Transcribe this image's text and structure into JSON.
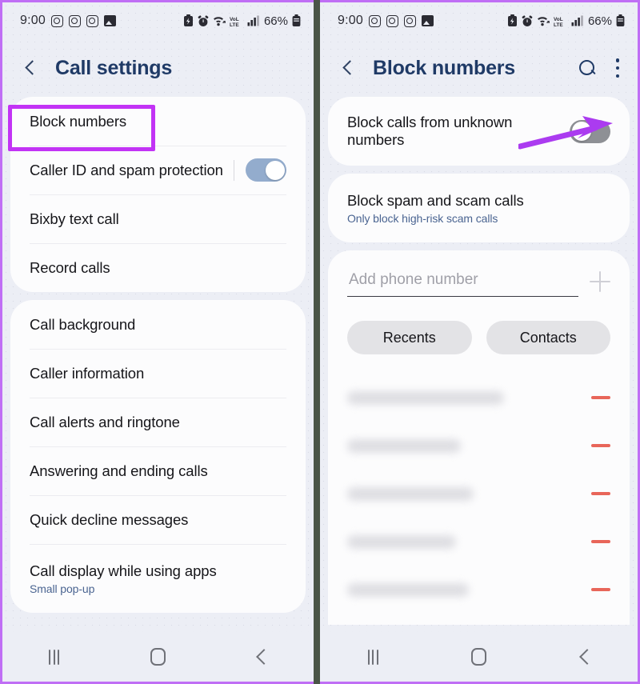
{
  "status_bar": {
    "time": "9:00",
    "left_icons": [
      "instagram-icon",
      "instagram-icon",
      "instagram-icon",
      "gallery-icon"
    ],
    "right_icons": [
      "battery-saver-icon",
      "alarm-icon",
      "wifi-calling-icon",
      "volte-icon",
      "signal-icon"
    ],
    "battery_percent": "66%"
  },
  "left_screen": {
    "header": {
      "back_icon": "back-chevron-icon",
      "title": "Call settings"
    },
    "group_1": [
      {
        "label": "Block numbers",
        "highlighted": true
      },
      {
        "label": "Caller ID and spam protection",
        "toggle": "on"
      },
      {
        "label": "Bixby text call"
      },
      {
        "label": "Record calls"
      }
    ],
    "group_2": [
      {
        "label": "Call background"
      },
      {
        "label": "Caller information"
      },
      {
        "label": "Call alerts and ringtone"
      },
      {
        "label": "Answering and ending calls"
      },
      {
        "label": "Quick decline messages"
      },
      {
        "label": "Call display while using apps",
        "sub": "Small pop-up"
      }
    ]
  },
  "right_screen": {
    "header": {
      "back_icon": "back-chevron-icon",
      "title": "Block numbers",
      "search_icon": "search-icon",
      "menu_icon": "kebab-menu-icon"
    },
    "unknown_numbers": {
      "label": "Block calls from unknown numbers",
      "toggle": "off"
    },
    "spam_calls": {
      "label": "Block spam and scam calls",
      "sub": "Only block high-risk scam calls"
    },
    "add_number": {
      "placeholder": "Add phone number",
      "value": "",
      "add_icon": "plus-icon"
    },
    "source_buttons": [
      {
        "label": "Recents"
      },
      {
        "label": "Contacts"
      }
    ],
    "blocked_list": [
      {
        "blurred": true,
        "remove_icon": "minus-icon"
      },
      {
        "blurred": true,
        "remove_icon": "minus-icon"
      },
      {
        "blurred": true,
        "remove_icon": "minus-icon"
      },
      {
        "blurred": true,
        "remove_icon": "minus-icon"
      },
      {
        "blurred": true,
        "remove_icon": "minus-icon"
      }
    ]
  },
  "nav_bar": {
    "recents_icon": "recents-icon",
    "home_icon": "home-icon",
    "back_icon": "back-icon"
  },
  "annotations": {
    "highlight_color": "#c233f5",
    "arrow_color": "#ab3bf0",
    "highlight_target": "Block numbers",
    "arrow_target": "unknown-numbers-toggle"
  },
  "colors": {
    "frame_border": "#c06ef5",
    "title_blue": "#1f3a66",
    "sub_blue": "#4a6491",
    "toggle_on": "#93accd",
    "toggle_off": "#8e9095",
    "minus_red": "#e8665a",
    "page_bg": "#eceef5",
    "card_bg": "#fcfcfd"
  }
}
